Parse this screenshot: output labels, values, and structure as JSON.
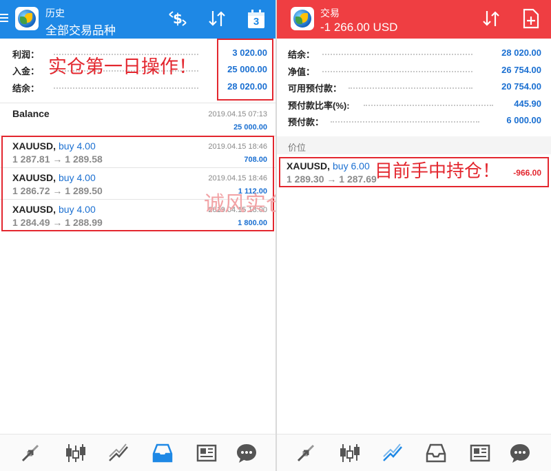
{
  "left": {
    "header": {
      "subtitle": "历史",
      "title": "全部交易品种",
      "calendar_day": "3"
    },
    "summary": [
      {
        "label": "利润：",
        "value": "3 020.00"
      },
      {
        "label": "入金：",
        "value": "25 000.00"
      },
      {
        "label": "结余：",
        "value": "28 020.00"
      }
    ],
    "balance": {
      "label": "Balance",
      "time": "2019.04.15 07:13",
      "amount": "25 000.00"
    },
    "deals": [
      {
        "symbol": "XAUUSD,",
        "action": "buy 4.00",
        "prices": "1 287.81 → 1 289.58",
        "time": "2019.04.15 18:46",
        "profit": "708.00"
      },
      {
        "symbol": "XAUUSD,",
        "action": "buy 4.00",
        "prices": "1 286.72 → 1 289.50",
        "time": "2019.04.15 18:46",
        "profit": "1 112.00"
      },
      {
        "symbol": "XAUUSD,",
        "action": "buy 4.00",
        "prices": "1 284.49 → 1 288.99",
        "time": "2019.04.15 18:00",
        "profit": "1 800.00"
      }
    ],
    "annotation": "实仓第一日操作！",
    "watermark": "诚风实仓案例！",
    "nav": [
      {
        "icon": "trade-arrows-icon"
      },
      {
        "icon": "candlestick-chart-icon"
      },
      {
        "icon": "trend-line-icon"
      },
      {
        "icon": "inbox-tray-icon",
        "active": true
      },
      {
        "icon": "news-icon"
      },
      {
        "icon": "chat-bubble-icon"
      }
    ]
  },
  "right": {
    "header": {
      "subtitle": "交易",
      "title": "-1 266.00 USD"
    },
    "summary": [
      {
        "label": "结余：",
        "value": "28 020.00"
      },
      {
        "label": "净值：",
        "value": "26 754.00"
      },
      {
        "label": "可用预付款：",
        "value": "20 754.00"
      },
      {
        "label": "预付款比率(%):",
        "value": "445.90"
      },
      {
        "label": "预付款：",
        "value": "6 000.00"
      }
    ],
    "section_label": "价位",
    "position": {
      "symbol": "XAUUSD,",
      "action": "buy 6.00",
      "prices": "1 289.30 → 1 287.69",
      "profit": "-966.00"
    },
    "annotation": "目前手中持仓！",
    "nav": [
      {
        "icon": "trade-arrows-icon"
      },
      {
        "icon": "candlestick-chart-icon"
      },
      {
        "icon": "trend-line-icon",
        "active": true
      },
      {
        "icon": "inbox-tray-icon"
      },
      {
        "icon": "news-icon"
      },
      {
        "icon": "chat-bubble-icon"
      }
    ]
  },
  "colors": {
    "blue_header": "#1e88e5",
    "red_header": "#ef3e42",
    "value_blue": "#1a6fd1",
    "loss_red": "#e3262e",
    "annotation_red": "#e3262e"
  }
}
